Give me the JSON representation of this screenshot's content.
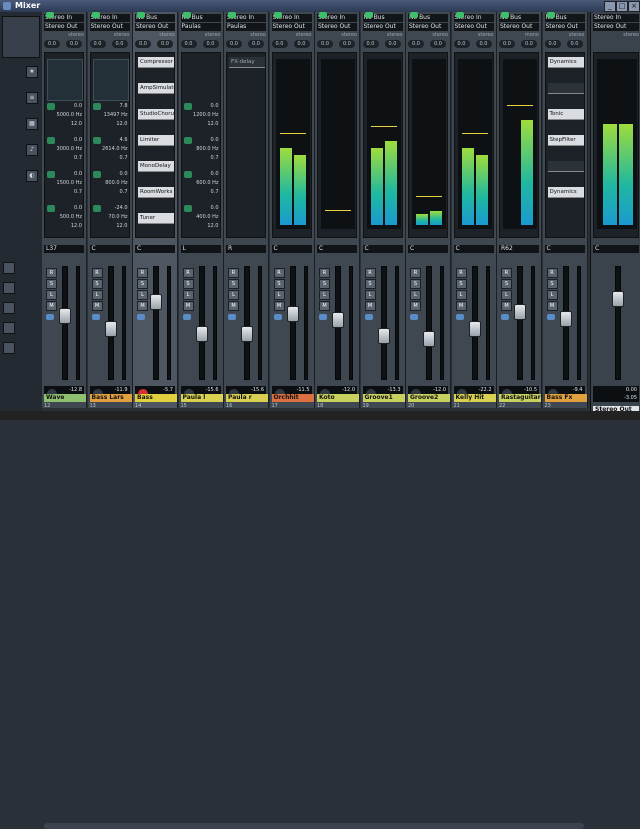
{
  "window": {
    "title": "Mixer"
  },
  "rail_icons": [
    "star",
    "bars",
    "grid",
    "mic",
    "speaker"
  ],
  "channels": [
    {
      "id": "wave",
      "name": "Wave",
      "number": "12",
      "in": "Stereo In",
      "out": "Stereo Out",
      "mode": "stereo",
      "pan": "L37",
      "vol_left": "-12.8",
      "vol_right": "-0.81",
      "name_color": "#8ec070",
      "type": "eq",
      "selected": false,
      "fader": 0.42,
      "meter_l": 0.0,
      "meter_r": 0.0,
      "eq": [
        "0.0",
        "5000.0 Hz",
        "12.0",
        "0.0",
        "3000.0 Hz",
        "0.7",
        "0.0",
        "1500.0 Hz",
        "0.7",
        "0.0",
        "500.0 Hz",
        "12.0"
      ]
    },
    {
      "id": "basslars",
      "name": "Bass Lars",
      "number": "13",
      "in": "Stereo In",
      "out": "Stereo Out",
      "mode": "stereo",
      "pan": "C",
      "vol_left": "-11.9",
      "vol_right": "-8.84",
      "name_color": "#e0a040",
      "type": "eq",
      "selected": false,
      "fader": 0.55,
      "meter_l": 0.0,
      "meter_r": 0.0,
      "eq": [
        "7.8",
        "13497 Hz",
        "12.0",
        "4.6",
        "2614.0 Hz",
        "0.7",
        "0.0",
        "800.0 Hz",
        "0.7",
        "-24.0",
        "70.0 Hz",
        "12.0"
      ]
    },
    {
      "id": "bass",
      "name": "Bass",
      "number": "14",
      "in": "No Bus",
      "out": "Stereo Out",
      "mode": "stereo",
      "pan": "C",
      "vol_left": "-5.7",
      "vol_right": "-0.01",
      "name_color": "#e0d040",
      "type": "inserts",
      "selected": true,
      "fader": 0.28,
      "meter_l": 0.1,
      "meter_r": 0.3,
      "inserts": [
        "Compressor",
        "AmpSimulator",
        "StudioChorus",
        "Limiter",
        "MonoDelay",
        "RoomWorks",
        "Tuner"
      ]
    },
    {
      "id": "paulal",
      "name": "Paula l",
      "number": "15",
      "in": "No Bus",
      "out": "Paulas",
      "mode": "stereo",
      "pan": "L",
      "vol_left": "-15.6",
      "vol_right": "-10.61",
      "name_color": "#d8d050",
      "type": "eq_plain",
      "selected": false,
      "fader": 0.6,
      "meter_l": 0.0,
      "meter_r": 0.0,
      "eq": [
        "0.0",
        "1200.0 Hz",
        "12.0",
        "0.0",
        "800.0 Hz",
        "0.7",
        "0.0",
        "600.0 Hz",
        "0.7",
        "0.0",
        "400.0 Hz",
        "12.0"
      ]
    },
    {
      "id": "paular",
      "name": "Paula r",
      "number": "16",
      "in": "Stereo In",
      "out": "Paulas",
      "mode": "stereo",
      "pan": "R",
      "vol_left": "-15.6",
      "vol_right": "-9.85",
      "name_color": "#d8d050",
      "type": "fx",
      "selected": false,
      "fader": 0.6,
      "meter_l": 0.0,
      "meter_r": 0.0,
      "fx_label": "FX-delay"
    },
    {
      "id": "orchhit",
      "name": "Orchhit",
      "number": "17",
      "in": "Stereo In",
      "out": "Stereo Out",
      "mode": "stereo",
      "pan": "C",
      "vol_left": "-11.5",
      "vol_right": "-1.99",
      "name_color": "#d87040",
      "type": "meter",
      "selected": false,
      "fader": 0.4,
      "meter_l": 0.55,
      "meter_r": 0.5
    },
    {
      "id": "koto",
      "name": "Koto",
      "number": "18",
      "in": "Stereo In",
      "out": "Stereo Out",
      "mode": "stereo",
      "pan": "C",
      "vol_left": "-12.0",
      "vol_right": "-1.51",
      "name_color": "#c8d060",
      "type": "meter",
      "selected": false,
      "fader": 0.46,
      "meter_l": 0.0,
      "meter_r": 0.0
    },
    {
      "id": "groove1",
      "name": "Groove1",
      "number": "19",
      "in": "No Bus",
      "out": "Stereo Out",
      "mode": "stereo",
      "pan": "C",
      "vol_left": "-13.3",
      "vol_right": "-4.65",
      "name_color": "#c8d060",
      "type": "meter",
      "selected": false,
      "fader": 0.62,
      "meter_l": 0.55,
      "meter_r": 0.6
    },
    {
      "id": "groove2",
      "name": "Groove2",
      "number": "20",
      "in": "No Bus",
      "out": "Stereo Out",
      "mode": "stereo",
      "pan": "C",
      "vol_left": "-12.0",
      "vol_right": "-15.03",
      "name_color": "#c8d060",
      "type": "meter",
      "selected": false,
      "fader": 0.65,
      "meter_l": 0.08,
      "meter_r": 0.1
    },
    {
      "id": "kellyhit",
      "name": "Kelly Hit",
      "number": "21",
      "in": "Stereo In",
      "out": "Stereo Out",
      "mode": "stereo",
      "pan": "C",
      "vol_left": "-22.2",
      "vol_right": "6.02",
      "name_color": "#d8d050",
      "type": "meter",
      "selected": false,
      "fader": 0.55,
      "meter_l": 0.55,
      "meter_r": 0.5
    },
    {
      "id": "rastaguitar",
      "name": "Rastaguitar",
      "number": "22",
      "in": "No Bus",
      "out": "Stereo Out",
      "mode": "mono",
      "pan": "R62",
      "vol_left": "-10.5",
      "vol_right": "-13.42",
      "name_color": "#c8d060",
      "type": "meter",
      "selected": false,
      "fader": 0.38,
      "meter_l": 0.0,
      "meter_r": 0.75
    },
    {
      "id": "bassfx",
      "name": "Bass Fx",
      "number": "23",
      "in": "No Bus",
      "out": "Stereo Out",
      "mode": "stereo",
      "pan": "C",
      "vol_left": "-9.4",
      "vol_right": "-16.29",
      "name_color": "#e0a040",
      "type": "inserts2",
      "selected": false,
      "fader": 0.45,
      "meter_l": 0.0,
      "meter_r": 0.0,
      "inserts": [
        "Dynamics",
        "",
        "Tonic",
        "StepFilter",
        "",
        "Dynamics"
      ]
    }
  ],
  "output": {
    "name": "Stereo Out",
    "in": "Stereo In",
    "out": "Stereo Out",
    "mode": "stereo",
    "pan": "C",
    "vol_left": "0.00",
    "vol_right": "-3.05",
    "meter_l": 0.72,
    "meter_r": 0.72,
    "fader": 0.25
  }
}
